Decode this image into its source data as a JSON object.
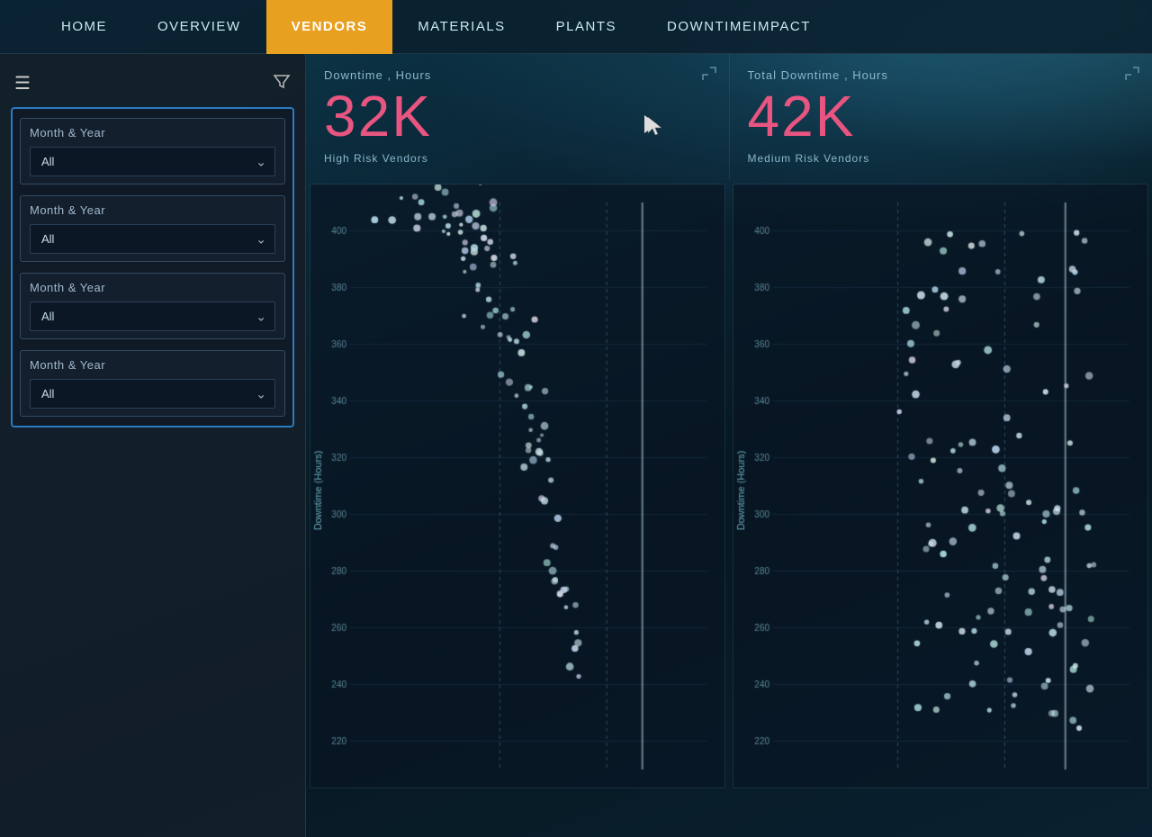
{
  "navbar": {
    "items": [
      {
        "label": "Home",
        "active": false
      },
      {
        "label": "Overview",
        "active": false
      },
      {
        "label": "Vendors",
        "active": true
      },
      {
        "label": "Materials",
        "active": false
      },
      {
        "label": "Plants",
        "active": false
      },
      {
        "label": "DowntimeImpact",
        "active": false
      }
    ]
  },
  "filter_panel": {
    "dropdowns": [
      {
        "label": "Month & Year",
        "value": "All",
        "placeholder": "All"
      },
      {
        "label": "Month & Year",
        "value": "All",
        "placeholder": "All"
      },
      {
        "label": "Month & Year",
        "value": "All",
        "placeholder": "All"
      },
      {
        "label": "Month & Year",
        "value": "All",
        "placeholder": "All"
      }
    ]
  },
  "kpi": {
    "left": {
      "label": "Downtime , Hours",
      "value": "32K",
      "sublabel": "High Risk Vendors"
    },
    "right": {
      "label": "Total Downtime , Hours",
      "value": "42K",
      "sublabel": "Medium Risk Vendors"
    }
  },
  "charts": {
    "left_y_axis": "Downtime (Hours)",
    "y_ticks": [
      "400",
      "380",
      "360",
      "340",
      "320",
      "300",
      "280",
      "260",
      "240",
      "220"
    ]
  },
  "icons": {
    "hamburger": "☰",
    "filter": "⚗",
    "chevron_down": "⌄",
    "expand": "⤢"
  }
}
